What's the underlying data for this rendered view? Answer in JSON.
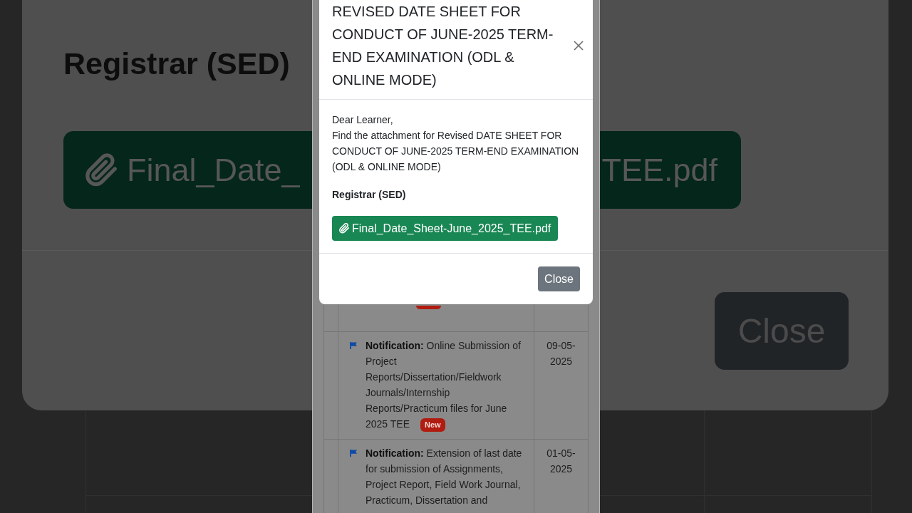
{
  "backdrop": {
    "heading": "Registrar (SED)",
    "attachment_button": {
      "visible_start": "Final_Date_",
      "visible_end": "TEE.pdf"
    },
    "close_button": "Close"
  },
  "page": {
    "rows": [
      {
        "kind": "covered",
        "new": true
      },
      {
        "kind": "notice",
        "text": "**Notification:** Online Submission of Project Reports/Dissertation/Fieldwork Journals/Internship Reports/Practicum files for June 2025 TEE",
        "badge": "New",
        "date": "09-05-2025"
      },
      {
        "kind": "notice",
        "text": "**Notification:** Extension of last date for submission of Assignments, Project Report, Field Work Journal, Practicum, Dissertation and",
        "date": "01-05-2025"
      }
    ]
  },
  "modal": {
    "title": "REVISED DATE SHEET FOR CONDUCT OF JUNE-2025 TERM-END EXAMINATION (ODL & ONLINE MODE)",
    "greeting": "Dear Learner,",
    "message": "Find the attachment for Revised DATE SHEET FOR CONDUCT OF JUNE-2025 TERM-END EXAMINATION (ODL & ONLINE MODE)",
    "signature": "Registrar (SED)",
    "attachment": "Final_Date_Sheet-June_2025_TEE.pdf",
    "close_button": "Close"
  }
}
